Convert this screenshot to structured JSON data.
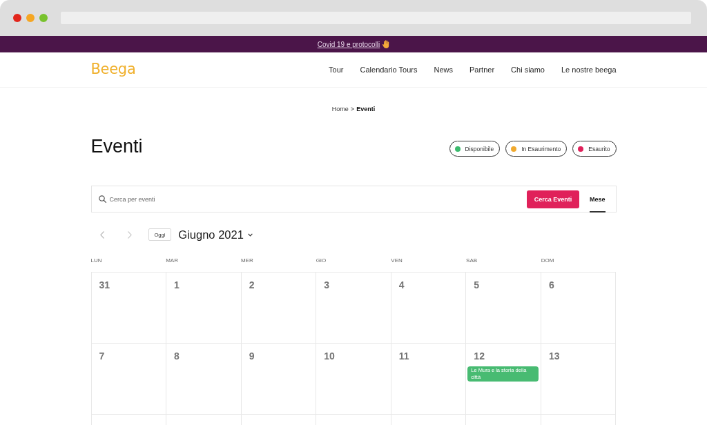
{
  "banner": {
    "link": "Covid 19 e protocolli"
  },
  "header": {
    "logo": "Beega",
    "nav": [
      "Tour",
      "Calendario Tours",
      "News",
      "Partner",
      "Chi siamo",
      "Le nostre beega"
    ]
  },
  "breadcrumb": {
    "items": [
      {
        "label": "Home",
        "current": false
      },
      {
        "label": "Eventi",
        "current": true
      }
    ],
    "separator": ">"
  },
  "title": "Eventi",
  "legend": [
    {
      "label": "Disponibile",
      "color": "#3cba6e"
    },
    {
      "label": "In Esaurimento",
      "color": "#f0a92e"
    },
    {
      "label": "Esaurito",
      "color": "#e0215a"
    }
  ],
  "search": {
    "placeholder": "Cerca per eventi",
    "button": "Cerca Eventi",
    "views": [
      {
        "label": "Mese",
        "selected": true
      }
    ]
  },
  "calendar": {
    "today_button": "Oggi",
    "month": "Giugno 2021",
    "weekdays": [
      "LUN",
      "MAR",
      "MER",
      "GIO",
      "VEN",
      "SAB",
      "DOM"
    ],
    "weeks": [
      [
        {
          "day": "31"
        },
        {
          "day": "1"
        },
        {
          "day": "2"
        },
        {
          "day": "3"
        },
        {
          "day": "4"
        },
        {
          "day": "5"
        },
        {
          "day": "6"
        }
      ],
      [
        {
          "day": "7"
        },
        {
          "day": "8"
        },
        {
          "day": "9"
        },
        {
          "day": "10"
        },
        {
          "day": "11"
        },
        {
          "day": "12",
          "events": [
            {
              "title": "Le Mura e la storia della città",
              "color": "#48bb72"
            }
          ]
        },
        {
          "day": "13"
        }
      ]
    ]
  }
}
